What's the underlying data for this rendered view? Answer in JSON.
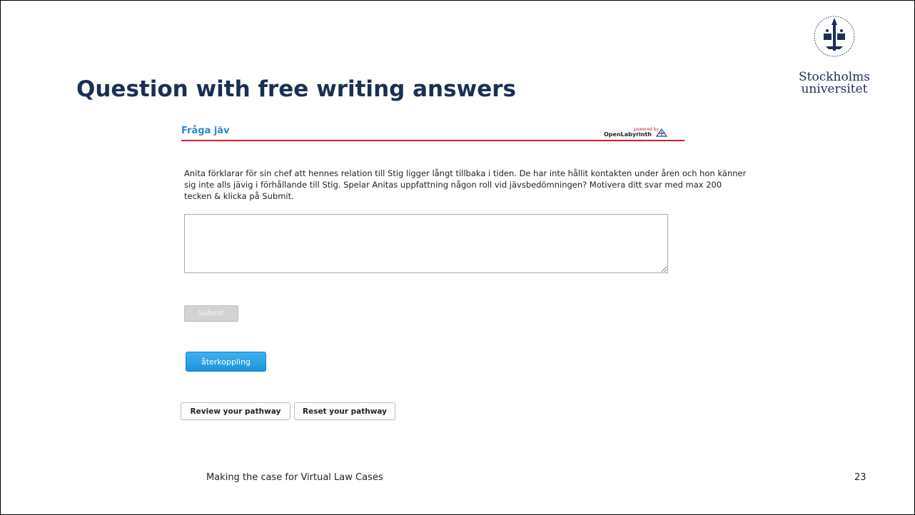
{
  "slide": {
    "title": "Question with free writing answers",
    "footer": "Making the case for Virtual Law Cases",
    "page_number": "23"
  },
  "logo": {
    "icon": "university-seal-icon",
    "line1": "Stockholms",
    "line2": "universitet"
  },
  "olab": {
    "node_title": "Fråga jäv",
    "brand_powered": "powered by",
    "brand_name": "OpenLabyrinth",
    "brand_icon": "openlabyrinth-logo-icon",
    "header_rule_color": "#d01f2d"
  },
  "question": {
    "text": "Anita förklarar för sin chef att hennes relation till Stig ligger långt tillbaka i tiden. De har inte hållit kontakten under åren och hon känner sig inte alls jävig i förhållande till Stig. Spelar Anitas uppfattning någon roll vid jävsbedömningen? Motivera ditt svar med max 200 tecken & klicka på Submit."
  },
  "answer": {
    "value": "",
    "placeholder": ""
  },
  "buttons": {
    "submit": "Submit",
    "feedback": "återkoppling",
    "review": "Review your pathway",
    "reset": "Reset your pathway"
  },
  "colors": {
    "title": "#1b2f55",
    "node_title": "#2f88c9",
    "feedback_button": "#1b94dc"
  }
}
